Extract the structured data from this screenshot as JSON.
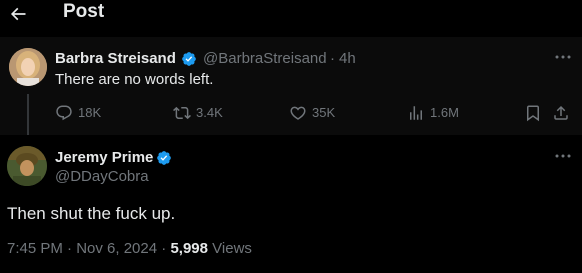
{
  "header": {
    "title": "Post",
    "back_icon": "arrow-left-icon"
  },
  "parent_post": {
    "display_name": "Barbra Streisand",
    "handle": "@BarbraStreisand",
    "separator": "·",
    "time": "4h",
    "text": "There are no words left.",
    "verified": true,
    "actions": {
      "replies": "18K",
      "reposts": "3.4K",
      "likes": "35K",
      "views": "1.6M"
    }
  },
  "reply_post": {
    "display_name": "Jeremy Prime",
    "handle": "@DDayCobra",
    "verified": true,
    "text": "Then shut the fuck up.",
    "timestamp": "7:45 PM · Nov 6, 2024",
    "meta_separator": "·",
    "views_count": "5,998",
    "views_label": "Views"
  },
  "colors": {
    "background": "#000000",
    "text_primary": "#e7e9ea",
    "text_secondary": "#71767b",
    "verified_blue": "#1d9bf0",
    "parent_bg": "#0b0b0b"
  }
}
